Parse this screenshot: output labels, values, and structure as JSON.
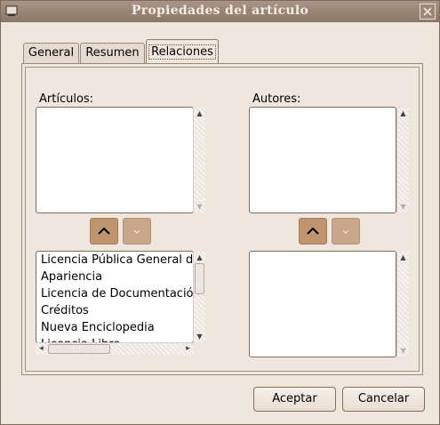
{
  "window": {
    "title": "Propiedades del artículo",
    "icon": "window-icon",
    "close_icon": "close-icon"
  },
  "tabs": [
    {
      "label": "General",
      "active": false
    },
    {
      "label": "Resumen",
      "active": false
    },
    {
      "label": "Relaciones",
      "active": true
    }
  ],
  "relaciones": {
    "articulos_label": "Artículos:",
    "autores_label": "Autores:",
    "articulos_selected": [],
    "autores_selected": [],
    "articulos_available": [
      "Licencia Pública General de GNU",
      "Apariencia",
      " Licencia de Documentación",
      "Créditos",
      "Nueva Enciclopedia",
      "Licencia Libre"
    ],
    "autores_available": [],
    "move_up_icon": "chevron-up-icon",
    "move_down_icon": "chevron-down-icon"
  },
  "buttons": {
    "accept": "Aceptar",
    "cancel": "Cancelar"
  },
  "colors": {
    "titlebar": "#8c7666",
    "move_button": "#bf9570",
    "background": "#efe6dd"
  }
}
